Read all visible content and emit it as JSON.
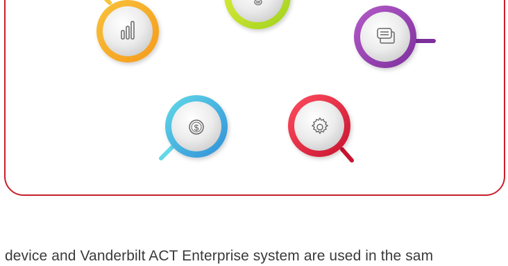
{
  "caption": "device and Vanderbilt ACT Enterprise system are used in the sam",
  "frame_color": "#c8202b",
  "icons": [
    {
      "name": "bar-chart-icon",
      "ring_colors": [
        "#f8c23a",
        "#f59a1b"
      ]
    },
    {
      "name": "document-icon",
      "ring_colors": [
        "#e6ee3c",
        "#9fd21f"
      ]
    },
    {
      "name": "chat-bubbles-icon",
      "ring_colors": [
        "#b45bc8",
        "#7d2f9d"
      ]
    },
    {
      "name": "dollar-coin-icon",
      "ring_colors": [
        "#63d9e8",
        "#2f8fd8"
      ]
    },
    {
      "name": "gear-icon",
      "ring_colors": [
        "#ff4d5e",
        "#c71430"
      ]
    }
  ]
}
